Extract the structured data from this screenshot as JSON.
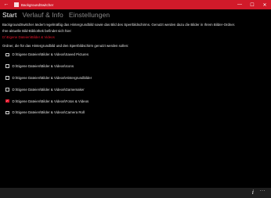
{
  "window": {
    "title": "BackgroundSwitcher",
    "back_glyph": "←",
    "minimize_glyph": "—",
    "maximize_glyph": "☐",
    "close_glyph": "✕",
    "accent_color": "#d11a2a"
  },
  "tabs": [
    {
      "label": "Start",
      "active": true
    },
    {
      "label": "Verlauf & Info",
      "active": false
    },
    {
      "label": "Einstellungen",
      "active": false
    }
  ],
  "content": {
    "description": "BackgroundSwitcher ändert regelmäßig das Hintergrundbild sowie das Bild des Sperrbildschirms. Genutzt werden dazu die Bilder in Ihrem Bilder-Ordner.",
    "path_label": "Ihre aktuelle Bild-Bibliothek befindet sich hier:",
    "path_value": "D:\\Eigene Dateien\\Bilder & Videos",
    "folder_prompt": "Ordner, die für das Hintergrundbild und den Sperrbildschirm genutzt werden sollen:"
  },
  "folders": [
    {
      "label": "D:\\Eigene Dateien\\Bilder & Videos\\Saved Pictures",
      "checked": false
    },
    {
      "label": "D:\\Eigene Dateien\\Bilder & Videos\\Icons",
      "checked": false
    },
    {
      "label": "D:\\Eigene Dateien\\Bilder & Videos\\Hintergrundbilder",
      "checked": false
    },
    {
      "label": "D:\\Eigene Dateien\\Bilder & Videos\\Gamemaker",
      "checked": false
    },
    {
      "label": "D:\\Eigene Dateien\\Bilder & Videos\\Fotos & Videos",
      "checked": true
    },
    {
      "label": "D:\\Eigene Dateien\\Bilder & Videos\\Camera Roll",
      "checked": false
    }
  ],
  "bottom_bar": {
    "info_glyph": "i",
    "more_glyph": "···"
  }
}
